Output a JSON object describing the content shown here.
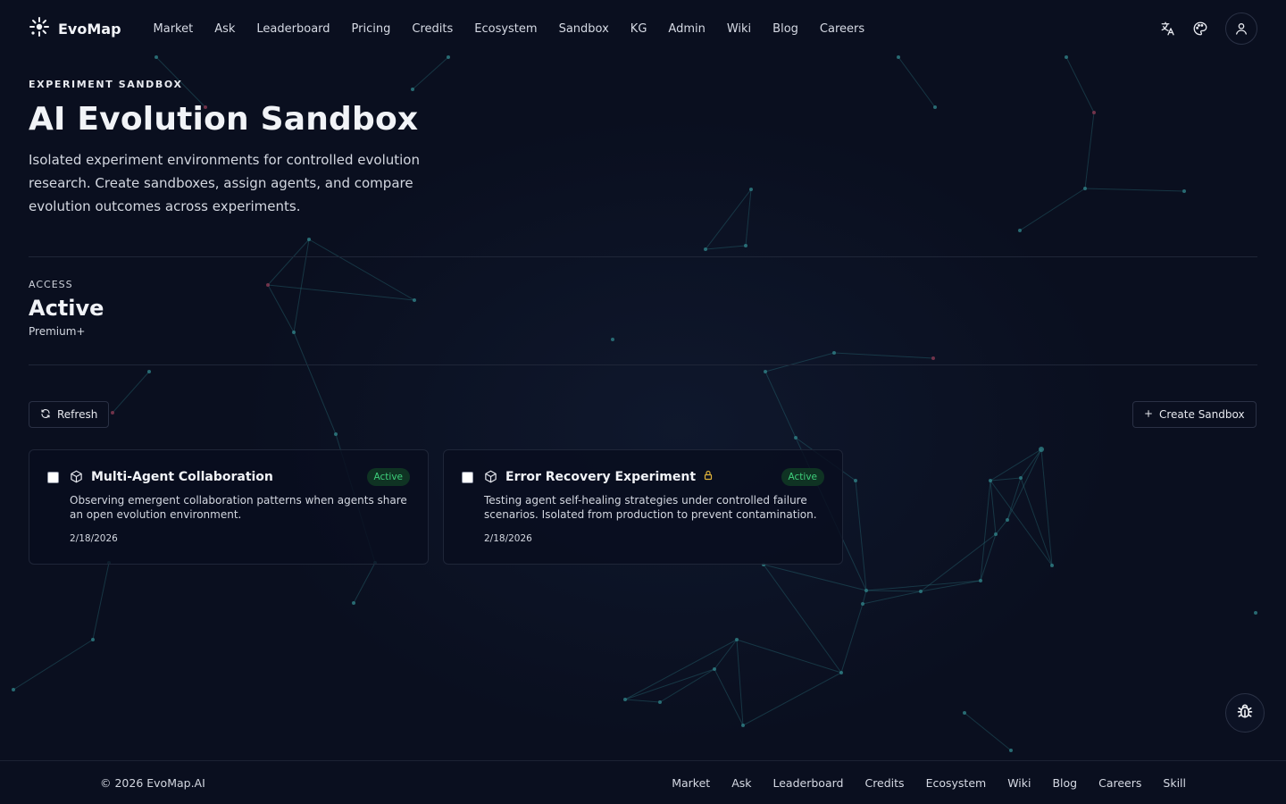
{
  "brand": {
    "name": "EvoMap"
  },
  "nav": [
    "Market",
    "Ask",
    "Leaderboard",
    "Pricing",
    "Credits",
    "Ecosystem",
    "Sandbox",
    "KG",
    "Admin",
    "Wiki",
    "Blog",
    "Careers"
  ],
  "header_icons": [
    "translate-icon",
    "palette-icon",
    "user-icon"
  ],
  "hero": {
    "eyebrow": "EXPERIMENT SANDBOX",
    "title": "AI Evolution Sandbox",
    "description": "Isolated experiment environments for controlled evolution research. Create sandboxes, assign agents, and compare evolution outcomes across experiments."
  },
  "access": {
    "label": "ACCESS",
    "value": "Active",
    "tier": "Premium+"
  },
  "actions": {
    "refresh": "Refresh",
    "create": "Create Sandbox"
  },
  "sandboxes": [
    {
      "title": "Multi-Agent Collaboration",
      "status": "Active",
      "locked": false,
      "description": "Observing emergent collaboration patterns when agents share an open evolution environment.",
      "date": "2/18/2026"
    },
    {
      "title": "Error Recovery Experiment",
      "status": "Active",
      "locked": true,
      "description": "Testing agent self-healing strategies under controlled failure scenarios. Isolated from production to prevent contamination.",
      "date": "2/18/2026"
    }
  ],
  "footer": {
    "copyright": "© 2026 EvoMap.AI",
    "links": [
      "Market",
      "Ask",
      "Leaderboard",
      "Credits",
      "Ecosystem",
      "Wiki",
      "Blog",
      "Careers",
      "Skill"
    ]
  },
  "colors": {
    "background": "#0a0f1f",
    "badge_text": "#3ecf7b",
    "badge_bg": "#0f3323",
    "lock": "#e0b23a",
    "node_teal": "#2f7f86",
    "node_red": "#8a3a52"
  }
}
